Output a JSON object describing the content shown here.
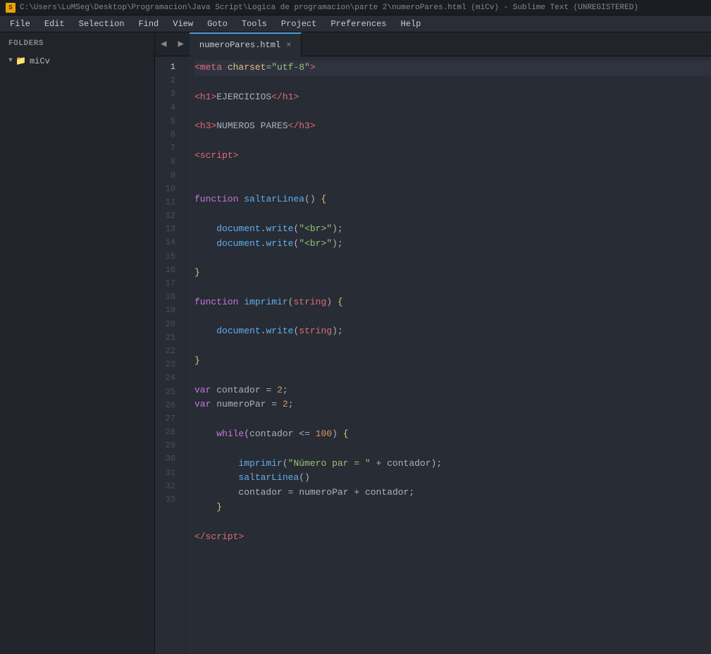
{
  "titlebar": {
    "icon": "S",
    "title": "C:\\Users\\LuMSeg\\Desktop\\Programacion\\Java Script\\Logica de programacion\\parte 2\\numeroPares.html (miCv) - Sublime Text (UNREGISTERED)"
  },
  "menubar": {
    "items": [
      "File",
      "Edit",
      "Selection",
      "Find",
      "View",
      "Goto",
      "Tools",
      "Project",
      "Preferences",
      "Help"
    ]
  },
  "sidebar": {
    "folders_label": "FOLDERS",
    "folder_name": "miCv"
  },
  "tab": {
    "filename": "numeroPares.html",
    "close_icon": "×"
  },
  "line_numbers": [
    1,
    2,
    3,
    4,
    5,
    6,
    7,
    8,
    9,
    10,
    11,
    12,
    13,
    14,
    15,
    16,
    17,
    18,
    19,
    20,
    21,
    22,
    23,
    24,
    25,
    26,
    27,
    28,
    29,
    30,
    31,
    32,
    33
  ]
}
